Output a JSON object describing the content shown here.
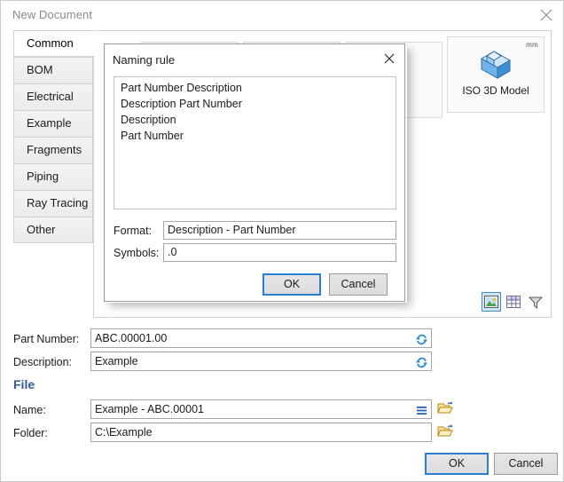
{
  "window": {
    "title": "New Document",
    "close_icon": "close-icon"
  },
  "sidebar": {
    "tabs": [
      {
        "label": "Common",
        "selected": true
      },
      {
        "label": "BOM",
        "selected": false
      },
      {
        "label": "Electrical",
        "selected": false
      },
      {
        "label": "Example",
        "selected": false
      },
      {
        "label": "Fragments",
        "selected": false
      },
      {
        "label": "Piping",
        "selected": false
      },
      {
        "label": "Ray Tracing",
        "selected": false
      },
      {
        "label": "Other",
        "selected": false
      }
    ]
  },
  "content": {
    "tiles": [
      {
        "label": "ISO 3D Model",
        "units": "mm",
        "icon": "cube-3d-icon"
      }
    ],
    "view_modes": [
      {
        "name": "thumbnail-view-icon",
        "active": true
      },
      {
        "name": "grid-view-icon",
        "active": false
      },
      {
        "name": "filter-icon",
        "active": false
      }
    ]
  },
  "form": {
    "part_number_label": "Part Number:",
    "part_number_value": "ABC.00001.00",
    "description_label": "Description:",
    "description_value": "Example",
    "file_section_header": "File",
    "name_label": "Name:",
    "name_value": "Example - ABC.00001",
    "folder_label": "Folder:",
    "folder_value": "C:\\Example",
    "refresh_icon": "refresh-icon",
    "menu_icon": "hamburger-menu-icon",
    "browse_icon": "open-folder-icon"
  },
  "footer": {
    "ok_label": "OK",
    "cancel_label": "Cancel"
  },
  "dialog": {
    "title": "Naming rule",
    "close_icon": "close-icon",
    "rules": [
      "Part Number Description",
      "Description Part Number",
      "Description",
      "Part Number"
    ],
    "format_label": "Format:",
    "format_value": "Description - Part Number",
    "symbols_label": "Symbols:",
    "symbols_value": ".0",
    "ok_label": "OK",
    "cancel_label": "Cancel"
  },
  "colors": {
    "accent_blue": "#2a7fd4",
    "section_header_blue": "#2e5c99",
    "title_grey": "#8a8a8a",
    "selection_blue": "#cde6f7"
  }
}
